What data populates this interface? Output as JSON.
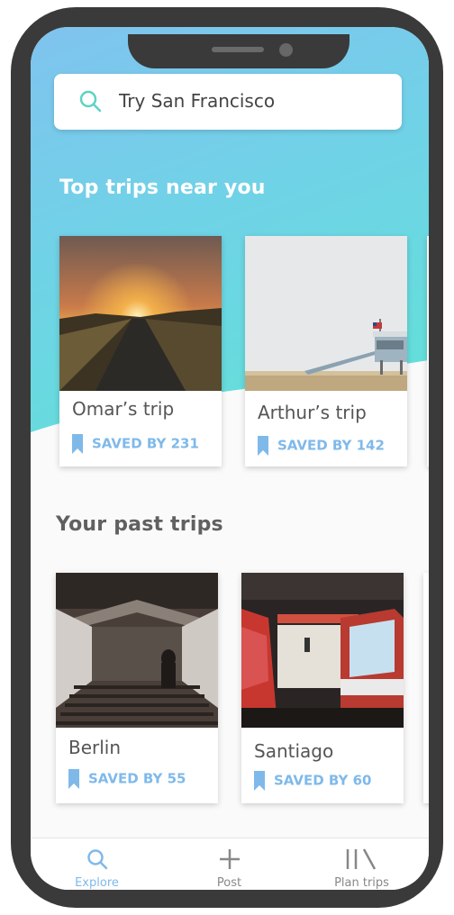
{
  "search": {
    "placeholder": "Try San Francisco"
  },
  "sections": {
    "top_trips_title": "Top trips near you",
    "past_trips_title": "Your past trips"
  },
  "top_trips": [
    {
      "name": "Omar’s trip",
      "saved": "SAVED BY 231"
    },
    {
      "name": "Arthur’s trip",
      "saved": "SAVED BY 142"
    }
  ],
  "past_trips": [
    {
      "name": "Berlin",
      "saved": "SAVED BY 55"
    },
    {
      "name": "Santiago",
      "saved": "SAVED BY 60"
    }
  ],
  "tabbar": {
    "tabs": [
      {
        "label": "Explore",
        "icon": "search-icon",
        "active": true
      },
      {
        "label": "Post",
        "icon": "plus-icon",
        "active": false
      },
      {
        "label": "Plan trips",
        "icon": "library-icon",
        "active": false
      }
    ]
  },
  "colors": {
    "accent": "#7fb9ea",
    "gradient_start": "#80c3ef",
    "gradient_end": "#5fe3d6",
    "search_icon": "#5ed3c2"
  }
}
